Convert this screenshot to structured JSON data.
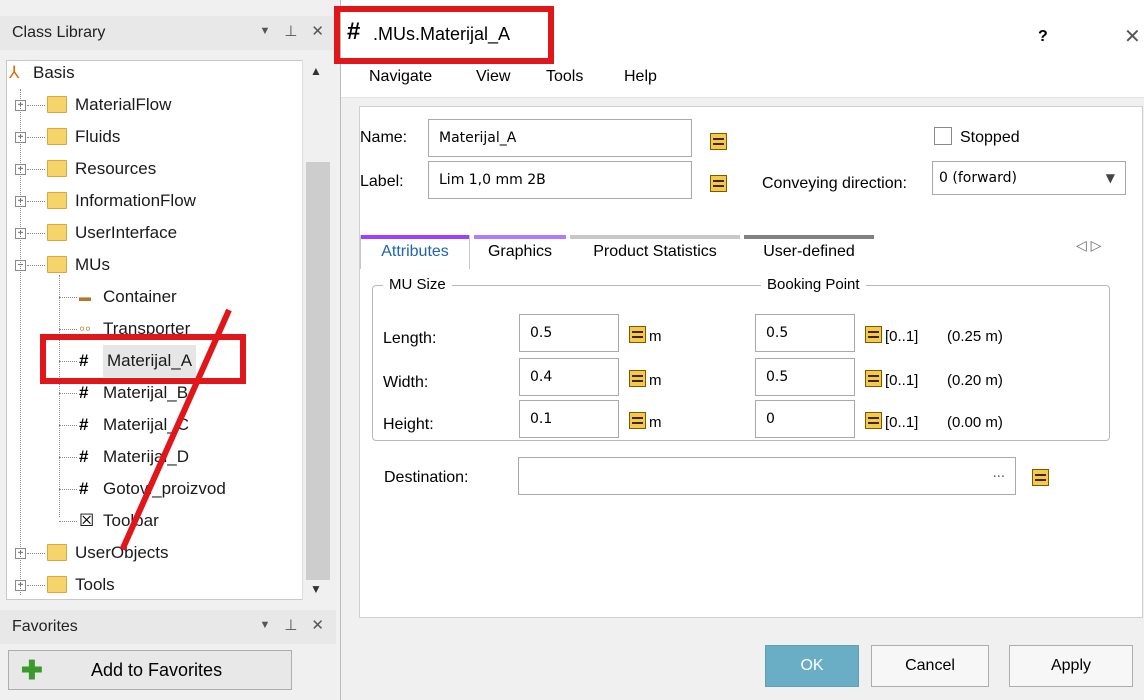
{
  "left_panel": {
    "class_library_title": "Class Library",
    "pin_glyph": "⊥",
    "close_glyph": "✕",
    "dropdown_glyph": "▼",
    "tree": [
      {
        "label": "Basis",
        "kind": "root"
      },
      {
        "label": "MaterialFlow",
        "kind": "folder"
      },
      {
        "label": "Fluids",
        "kind": "folder"
      },
      {
        "label": "Resources",
        "kind": "folder"
      },
      {
        "label": "InformationFlow",
        "kind": "folder"
      },
      {
        "label": "UserInterface",
        "kind": "folder"
      },
      {
        "label": "MUs",
        "kind": "folder-open"
      },
      {
        "label": "Container",
        "kind": "item"
      },
      {
        "label": "Transporter",
        "kind": "item"
      },
      {
        "label": "Materijal_A",
        "kind": "item-selected"
      },
      {
        "label": "Materijal_B",
        "kind": "item"
      },
      {
        "label": "Materijal_C",
        "kind": "item"
      },
      {
        "label": "Materijal_D",
        "kind": "item"
      },
      {
        "label": "Gotovi_proizvod",
        "kind": "item"
      },
      {
        "label": "Toolbar",
        "kind": "item"
      },
      {
        "label": "UserObjects",
        "kind": "folder"
      },
      {
        "label": "Tools",
        "kind": "folder"
      }
    ],
    "favorites_title": "Favorites",
    "add_to_favorites": "Add to Favorites"
  },
  "dialog": {
    "title": ".MUs.Materijal_A",
    "help": "?",
    "close": "✕",
    "menu": [
      "Navigate",
      "View",
      "Tools",
      "Help"
    ],
    "name_label": "Name:",
    "name_value": "Materijal_A",
    "label_label": "Label:",
    "label_value": "Lim 1,0 mm 2B",
    "stopped_label": "Stopped",
    "conveying_label": "Conveying direction:",
    "conveying_value": "0 (forward)",
    "tabs": [
      "Attributes",
      "Graphics",
      "Product Statistics",
      "User-defined"
    ],
    "tab_colors": [
      "#a040ff",
      "#b07cff",
      "#c8c8c8",
      "#808080"
    ],
    "mu_size_title": "MU Size",
    "booking_point_title": "Booking Point",
    "rows": [
      {
        "label": "Length:",
        "size": "0.5",
        "unit": "m",
        "bp": "0.5",
        "range": "[0..1]",
        "abs": "(0.25 m)"
      },
      {
        "label": "Width:",
        "size": "0.4",
        "unit": "m",
        "bp": "0.5",
        "range": "[0..1]",
        "abs": "(0.20 m)"
      },
      {
        "label": "Height:",
        "size": "0.1",
        "unit": "m",
        "bp": "0",
        "range": "[0..1]",
        "abs": "(0.00 m)"
      }
    ],
    "destination_label": "Destination:",
    "destination_value": "",
    "destination_ellipsis": "...",
    "ok": "OK",
    "cancel": "Cancel",
    "apply": "Apply"
  },
  "colors": {
    "highlight": "#e0161b",
    "ok_button": "#6aaec6",
    "active_tab_text": "#1e63b4"
  }
}
